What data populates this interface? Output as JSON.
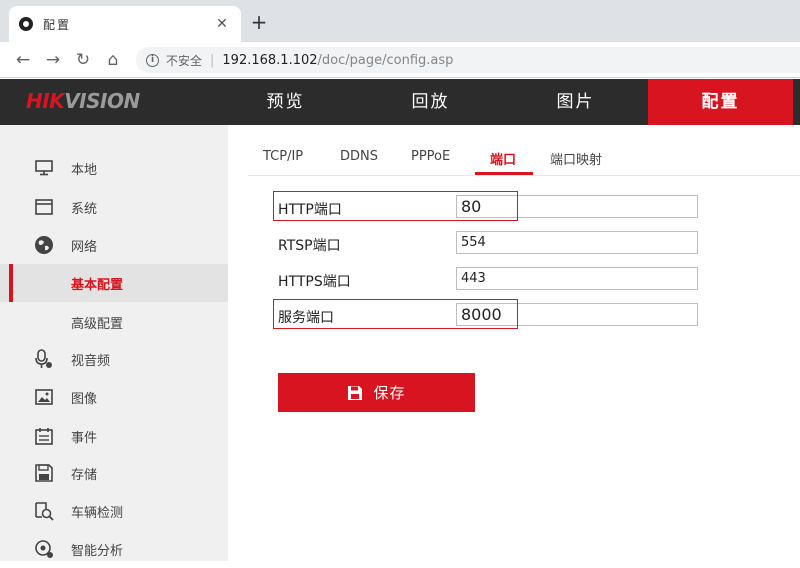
{
  "browser": {
    "tab_title": "配置",
    "new_tab": "+",
    "close": "✕",
    "back": "←",
    "forward": "→",
    "reload": "↻",
    "home": "⌂",
    "insecure_label": "不安全",
    "url_host": "192.168.1.102",
    "url_path": "/doc/page/config.asp"
  },
  "header": {
    "logo_part1": "HIK",
    "logo_part2": "VISION",
    "nav": [
      "预览",
      "回放",
      "图片",
      "配置"
    ],
    "active_nav": "配置",
    "accent_color": "#d7141f"
  },
  "sidebar": {
    "items": [
      {
        "label": "本地",
        "icon": "monitor-icon"
      },
      {
        "label": "系统",
        "icon": "window-icon"
      },
      {
        "label": "网络",
        "icon": "globe-icon"
      },
      {
        "label": "基本配置",
        "icon": "",
        "active": true
      },
      {
        "label": "高级配置",
        "icon": ""
      },
      {
        "label": "视音频",
        "icon": "microphone-icon"
      },
      {
        "label": "图像",
        "icon": "image-icon"
      },
      {
        "label": "事件",
        "icon": "calendar-icon"
      },
      {
        "label": "存储",
        "icon": "floppy-disk-icon"
      },
      {
        "label": "车辆检测",
        "icon": "vehicle-search-icon"
      },
      {
        "label": "智能分析",
        "icon": "analysis-icon"
      }
    ]
  },
  "subtabs": [
    "TCP/IP",
    "DDNS",
    "PPPoE",
    "端口",
    "端口映射"
  ],
  "active_subtab": "端口",
  "fields": [
    {
      "label": "HTTP端口",
      "value": "80",
      "highlighted": true
    },
    {
      "label": "RTSP端口",
      "value": "554",
      "highlighted": false
    },
    {
      "label": "HTTPS端口",
      "value": "443",
      "highlighted": false
    },
    {
      "label": "服务端口",
      "value": "8000",
      "highlighted": true
    }
  ],
  "save_label": "保存"
}
